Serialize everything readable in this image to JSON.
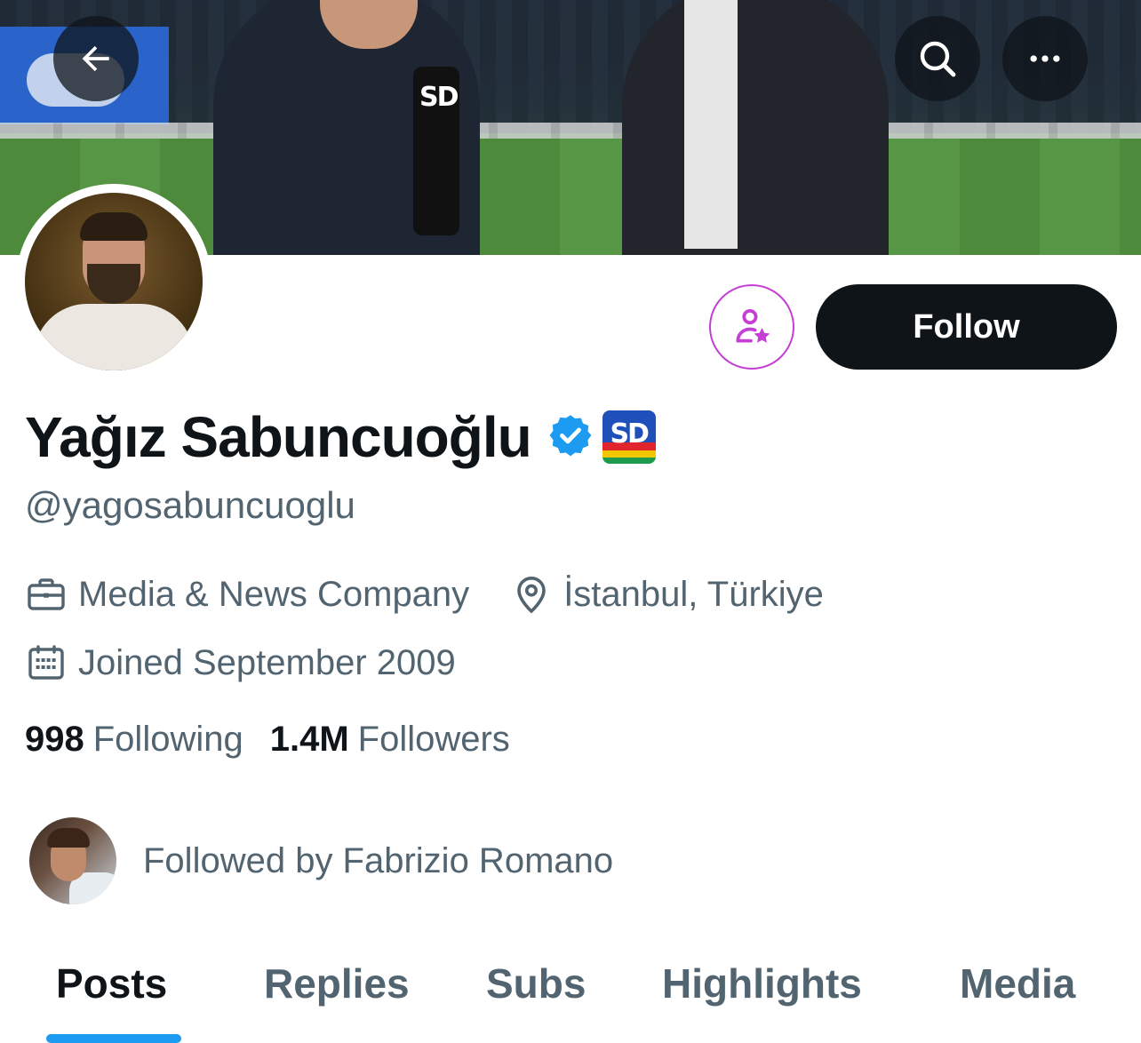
{
  "profile": {
    "display_name": "Yağız Sabuncuoğlu",
    "handle": "@yagosabuncuoglu",
    "affiliate_badge_text": "SD",
    "category": "Media & News Company",
    "location": "İstanbul, Türkiye",
    "joined": "Joined September 2009"
  },
  "banner": {
    "mic_label": "SD"
  },
  "actions": {
    "follow_label": "Follow"
  },
  "stats": {
    "following_count": "998",
    "following_label": "Following",
    "followers_count": "1.4M",
    "followers_label": "Followers"
  },
  "followed_by": {
    "text": "Followed by Fabrizio Romano"
  },
  "tabs": [
    {
      "label": "Posts",
      "active": true
    },
    {
      "label": "Replies",
      "active": false
    },
    {
      "label": "Subs",
      "active": false
    },
    {
      "label": "Highlights",
      "active": false
    },
    {
      "label": "Media",
      "active": false
    }
  ],
  "colors": {
    "accent": "#1d9bf0",
    "text_primary": "#0f1419",
    "text_secondary": "#536471",
    "notify_outline": "#c53fd6",
    "verified": "#1d9bf0"
  },
  "icons": {
    "back": "arrow-left-icon",
    "search": "search-icon",
    "more": "more-horizontal-icon",
    "notify": "person-star-icon",
    "verified": "verified-badge-icon",
    "category": "briefcase-icon",
    "location": "location-pin-icon",
    "joined": "calendar-icon"
  }
}
